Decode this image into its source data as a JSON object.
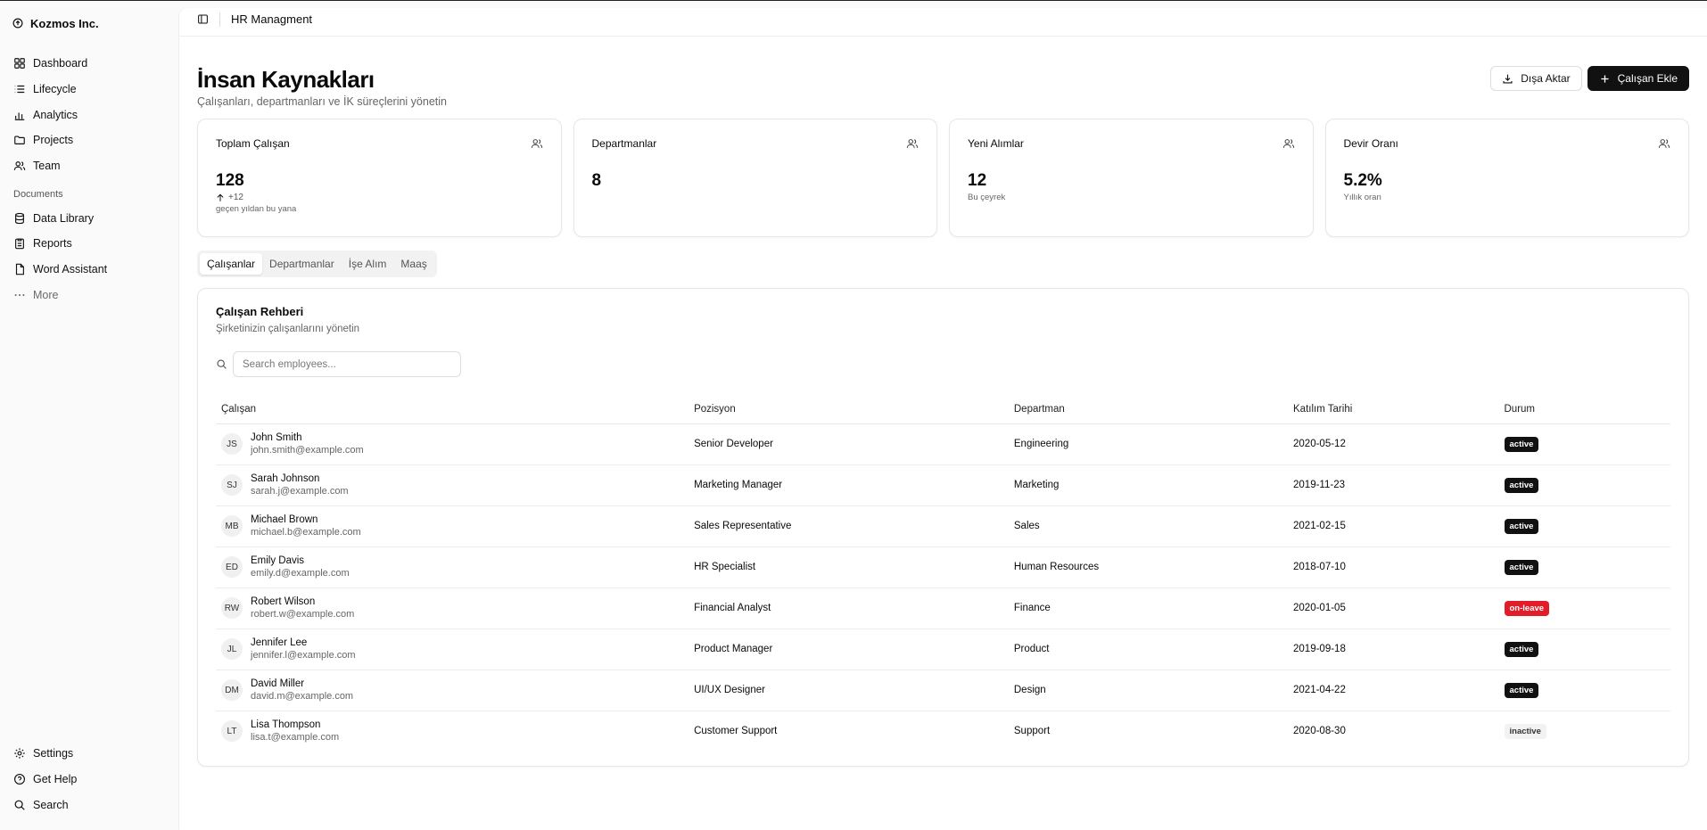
{
  "sidebar": {
    "brand": "Kozmos Inc.",
    "nav": [
      {
        "label": "Dashboard",
        "icon": "grid-icon"
      },
      {
        "label": "Lifecycle",
        "icon": "list-icon"
      },
      {
        "label": "Analytics",
        "icon": "bar-chart-icon"
      },
      {
        "label": "Projects",
        "icon": "folder-icon"
      },
      {
        "label": "Team",
        "icon": "users-icon"
      }
    ],
    "documents_label": "Documents",
    "documents": [
      {
        "label": "Data Library",
        "icon": "database-icon"
      },
      {
        "label": "Reports",
        "icon": "clipboard-icon"
      },
      {
        "label": "Word Assistant",
        "icon": "file-icon"
      }
    ],
    "more_label": "More",
    "footer": [
      {
        "label": "Settings",
        "icon": "gear-icon"
      },
      {
        "label": "Get Help",
        "icon": "help-icon"
      },
      {
        "label": "Search",
        "icon": "search-icon"
      }
    ]
  },
  "topbar": {
    "title": "HR Managment"
  },
  "header": {
    "title": "İnsan Kaynakları",
    "subtitle": "Çalışanları, departmanları ve İK süreçlerini yönetin",
    "export_label": "Dışa Aktar",
    "add_label": "Çalışan Ekle"
  },
  "stats": [
    {
      "label": "Toplam Çalışan",
      "value": "128",
      "delta": "+12",
      "note": "geçen yıldan bu yana"
    },
    {
      "label": "Departmanlar",
      "value": "8",
      "delta": "",
      "note": ""
    },
    {
      "label": "Yeni Alımlar",
      "value": "12",
      "delta": "",
      "note": "Bu çeyrek"
    },
    {
      "label": "Devir Oranı",
      "value": "5.2%",
      "delta": "",
      "note": "Yıllık oran"
    }
  ],
  "tabs": [
    "Çalışanlar",
    "Departmanlar",
    "İşe Alım",
    "Maaş"
  ],
  "directory": {
    "title": "Çalışan Rehberi",
    "subtitle": "Şirketinizin çalışanlarını yönetin",
    "search_placeholder": "Search employees...",
    "columns": [
      "Çalışan",
      "Pozisyon",
      "Departman",
      "Katılım Tarihi",
      "Durum"
    ],
    "rows": [
      {
        "initials": "JS",
        "name": "John Smith",
        "email": "john.smith@example.com",
        "position": "Senior Developer",
        "department": "Engineering",
        "date": "2020-05-12",
        "status": "active"
      },
      {
        "initials": "SJ",
        "name": "Sarah Johnson",
        "email": "sarah.j@example.com",
        "position": "Marketing Manager",
        "department": "Marketing",
        "date": "2019-11-23",
        "status": "active"
      },
      {
        "initials": "MB",
        "name": "Michael Brown",
        "email": "michael.b@example.com",
        "position": "Sales Representative",
        "department": "Sales",
        "date": "2021-02-15",
        "status": "active"
      },
      {
        "initials": "ED",
        "name": "Emily Davis",
        "email": "emily.d@example.com",
        "position": "HR Specialist",
        "department": "Human Resources",
        "date": "2018-07-10",
        "status": "active"
      },
      {
        "initials": "RW",
        "name": "Robert Wilson",
        "email": "robert.w@example.com",
        "position": "Financial Analyst",
        "department": "Finance",
        "date": "2020-01-05",
        "status": "on-leave"
      },
      {
        "initials": "JL",
        "name": "Jennifer Lee",
        "email": "jennifer.l@example.com",
        "position": "Product Manager",
        "department": "Product",
        "date": "2019-09-18",
        "status": "active"
      },
      {
        "initials": "DM",
        "name": "David Miller",
        "email": "david.m@example.com",
        "position": "UI/UX Designer",
        "department": "Design",
        "date": "2021-04-22",
        "status": "active"
      },
      {
        "initials": "LT",
        "name": "Lisa Thompson",
        "email": "lisa.t@example.com",
        "position": "Customer Support",
        "department": "Support",
        "date": "2020-08-30",
        "status": "inactive"
      }
    ]
  }
}
